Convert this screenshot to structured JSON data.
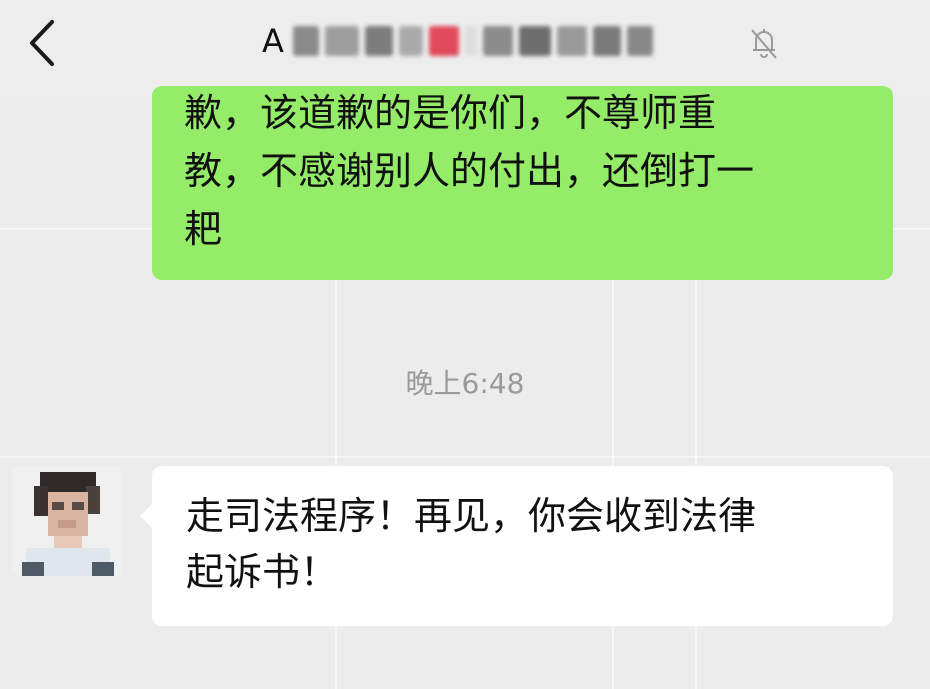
{
  "header": {
    "title_visible": "A",
    "back_icon": "chevron-left-icon",
    "mute_icon": "bell-off-icon"
  },
  "messages": {
    "sent": {
      "lines": [
        "歉，该道歉的是你们，不尊师重",
        "教，不感谢别人的付出，还倒打一",
        "耙"
      ]
    },
    "timestamp": "晚上6:48",
    "received": {
      "lines": [
        "走司法程序！再见，你会收到法律",
        "起诉书！"
      ]
    }
  },
  "colors": {
    "background": "#ececec",
    "sent_bubble": "#95ec69",
    "received_bubble": "#ffffff",
    "timestamp": "#9a9a9a"
  }
}
